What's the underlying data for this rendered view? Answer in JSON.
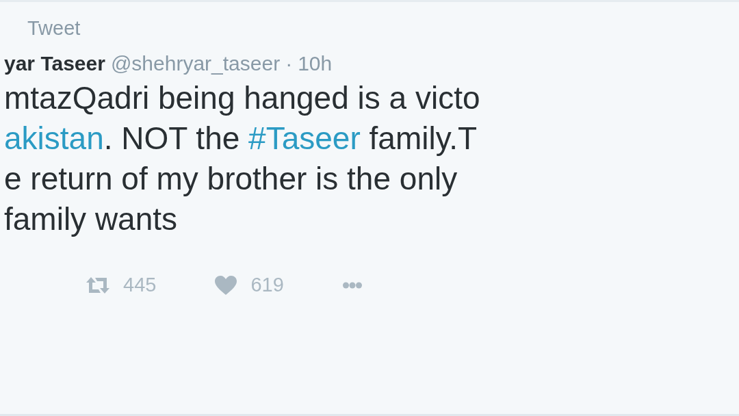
{
  "header": {
    "label": "Tweet"
  },
  "author": {
    "name": "yar Taseer",
    "handle": "@shehryar_taseer",
    "separator": "·",
    "time": "10h"
  },
  "lines": [
    [
      {
        "kind": "text",
        "text": "mtazQadri being hanged is a victo"
      }
    ],
    [
      {
        "kind": "hashtag",
        "text": "akistan"
      },
      {
        "kind": "text",
        "text": ". NOT the "
      },
      {
        "kind": "hashtag",
        "text": "#Taseer"
      },
      {
        "kind": "text",
        "text": " family.T"
      }
    ],
    [
      {
        "kind": "text",
        "text": "e return of my brother is the only"
      }
    ],
    [
      {
        "kind": "text",
        "text": "family wants"
      }
    ]
  ],
  "actions": [
    {
      "kind": "retweet",
      "count": "445"
    },
    {
      "kind": "like",
      "count": "619"
    },
    {
      "kind": "more"
    }
  ]
}
